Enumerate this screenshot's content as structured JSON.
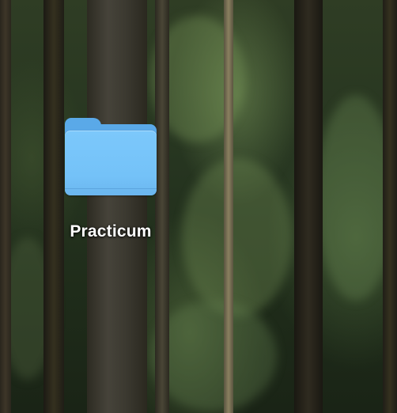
{
  "desktop": {
    "wallpaper": "forest",
    "icons": [
      {
        "label": "Practicum",
        "icon": "folder-icon",
        "color": "#74c2f8"
      }
    ]
  }
}
